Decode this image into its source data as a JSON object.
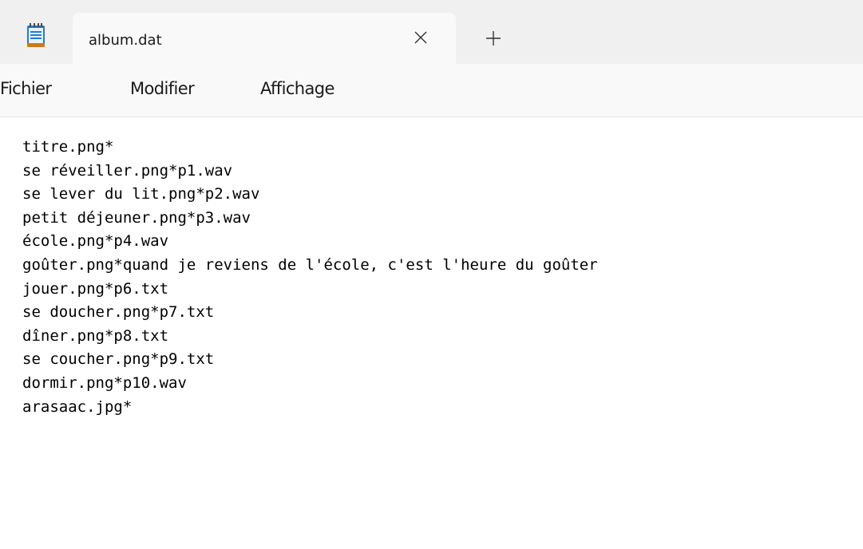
{
  "tab": {
    "title": "album.dat"
  },
  "icons": {
    "app": "notepad-icon",
    "close": "close-icon",
    "new_tab": "plus-icon"
  },
  "menu": {
    "items": [
      "Fichier",
      "Modifier",
      "Affichage"
    ]
  },
  "document": {
    "lines": [
      "titre.png*",
      "se réveiller.png*p1.wav",
      "se lever du lit.png*p2.wav",
      "petit déjeuner.png*p3.wav",
      "école.png*p4.wav",
      "goûter.png*quand je reviens de l'école, c'est l'heure du goûter",
      "jouer.png*p6.txt",
      "se doucher.png*p7.txt",
      "dîner.png*p8.txt",
      "se coucher.png*p9.txt",
      "dormir.png*p10.wav",
      "arasaac.jpg*"
    ]
  },
  "colors": {
    "titlebar_bg": "#f0f0f0",
    "tab_bg": "#f9f9f9",
    "menubar_bg": "#f9f9f9",
    "editor_bg": "#ffffff",
    "icon_accent": "#1e7bd3"
  }
}
